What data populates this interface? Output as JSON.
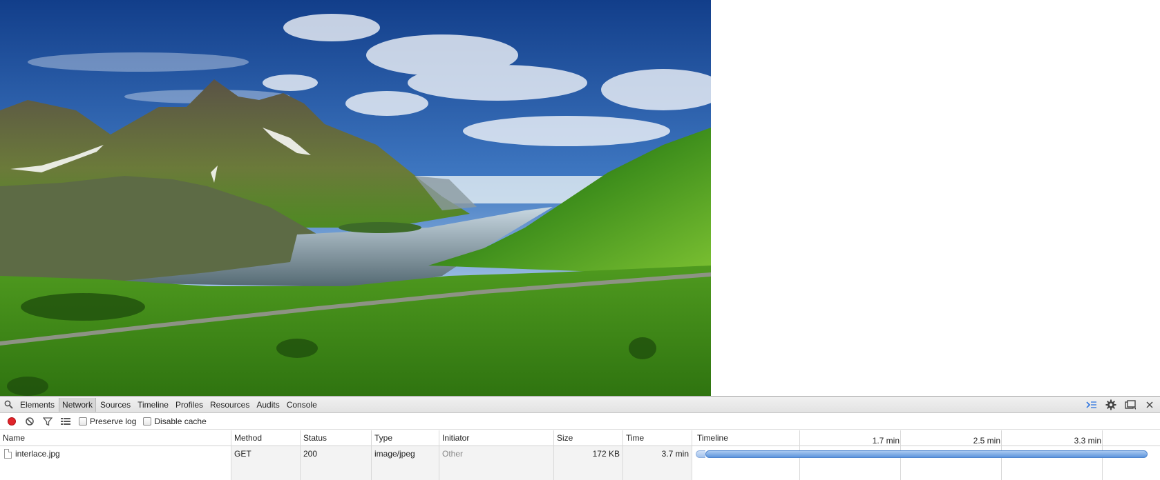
{
  "devtools": {
    "tabs": [
      {
        "label": "Elements",
        "active": false
      },
      {
        "label": "Network",
        "active": true
      },
      {
        "label": "Sources",
        "active": false
      },
      {
        "label": "Timeline",
        "active": false
      },
      {
        "label": "Profiles",
        "active": false
      },
      {
        "label": "Resources",
        "active": false
      },
      {
        "label": "Audits",
        "active": false
      },
      {
        "label": "Console",
        "active": false
      }
    ],
    "right_icons": [
      "console-drawer-icon",
      "gear-icon",
      "dock-icon",
      "close-icon"
    ],
    "network_toolbar": {
      "icons": [
        "record-icon",
        "clear-icon",
        "filter-icon",
        "list-view-icon"
      ],
      "record_color": "#e0242a",
      "preserve_log_label": "Preserve log",
      "preserve_log_checked": false,
      "disable_cache_label": "Disable cache",
      "disable_cache_checked": false
    },
    "columns": {
      "name": "Name",
      "method": "Method",
      "status": "Status",
      "type": "Type",
      "initiator": "Initiator",
      "size": "Size",
      "time": "Time",
      "timeline": "Timeline"
    },
    "timeline_ticks": [
      "1.7 min",
      "2.5 min",
      "3.3 min"
    ],
    "rows": [
      {
        "name": "interlace.jpg",
        "method": "GET",
        "status": "200",
        "type": "image/jpeg",
        "initiator": "Other",
        "size": "172 KB",
        "time": "3.7 min"
      }
    ],
    "timeline_bar_color": "#5e95dd"
  }
}
